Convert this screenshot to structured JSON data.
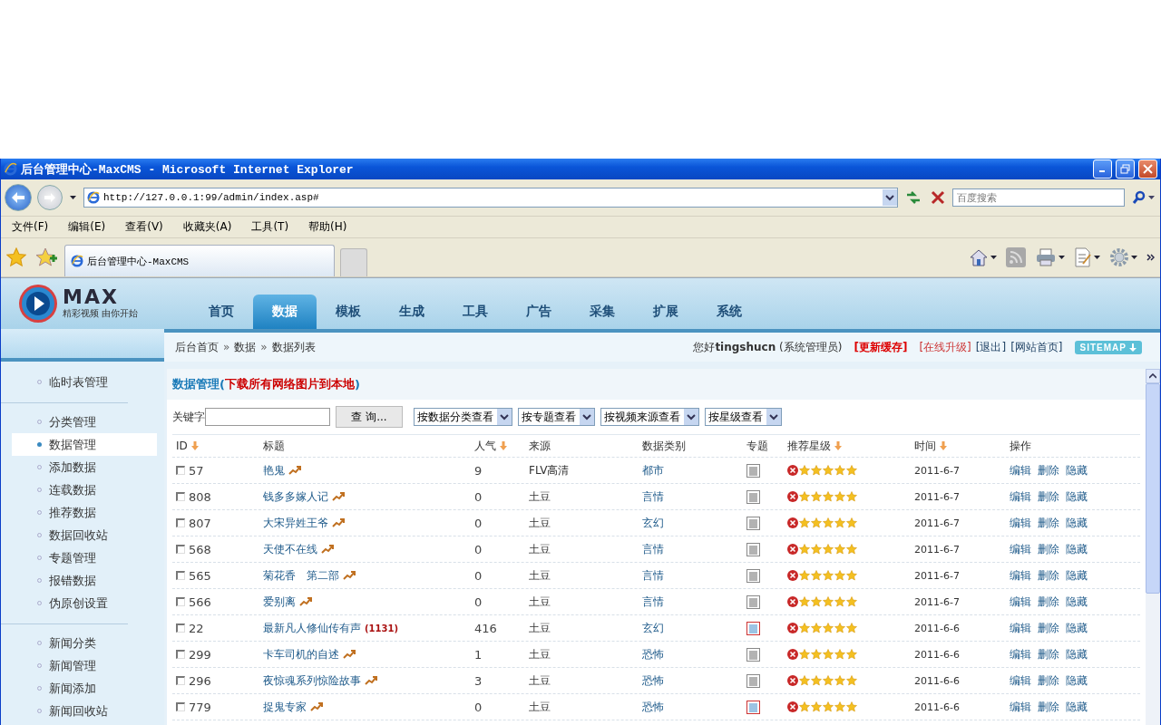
{
  "browser": {
    "title": "后台管理中心-MaxCMS - Microsoft Internet Explorer",
    "address": "http://127.0.0.1:99/admin/index.asp#",
    "search_placeholder": "百度搜索",
    "menu": [
      "文件(F)",
      "编辑(E)",
      "查看(V)",
      "收藏夹(A)",
      "工具(T)",
      "帮助(H)"
    ],
    "tab": "后台管理中心-MaxCMS"
  },
  "logo": {
    "wordmark": "MAX",
    "slogan": "精彩视频 由你开始"
  },
  "nav": [
    {
      "label": "首页",
      "selected": false
    },
    {
      "label": "数据",
      "selected": true
    },
    {
      "label": "模板",
      "selected": false
    },
    {
      "label": "生成",
      "selected": false
    },
    {
      "label": "工具",
      "selected": false
    },
    {
      "label": "广告",
      "selected": false
    },
    {
      "label": "采集",
      "selected": false
    },
    {
      "label": "扩展",
      "selected": false
    },
    {
      "label": "系统",
      "selected": false
    }
  ],
  "breadcrumb": {
    "separator": "»",
    "items": [
      "后台首页",
      "数据",
      "数据列表"
    ]
  },
  "user": {
    "greeting": "您好",
    "name": "tingshucn",
    "role": "(系统管理员)",
    "sitemap": "SITEMAP",
    "links": [
      {
        "label": "[更新缓存]",
        "kind": "strong"
      },
      {
        "label": "[在线升级]",
        "kind": "warn"
      },
      {
        "label": "[退出]",
        "kind": "plain"
      },
      {
        "label": "[网站首页]",
        "kind": "plain"
      }
    ]
  },
  "sidebar": {
    "groups": [
      [
        {
          "label": "临时表管理",
          "selected": false
        }
      ],
      [
        {
          "label": "分类管理",
          "selected": false
        },
        {
          "label": "数据管理",
          "selected": true
        },
        {
          "label": "添加数据",
          "selected": false
        },
        {
          "label": "连载数据",
          "selected": false
        },
        {
          "label": "推荐数据",
          "selected": false
        },
        {
          "label": "数据回收站",
          "selected": false
        },
        {
          "label": "专题管理",
          "selected": false
        },
        {
          "label": "报错数据",
          "selected": false
        },
        {
          "label": "伪原创设置",
          "selected": false
        }
      ],
      [
        {
          "label": "新闻分类",
          "selected": false
        },
        {
          "label": "新闻管理",
          "selected": false
        },
        {
          "label": "新闻添加",
          "selected": false
        },
        {
          "label": "新闻回收站",
          "selected": false
        }
      ]
    ]
  },
  "panel": {
    "title": "数据管理",
    "paren_open": "(",
    "link": "下载所有网络图片到本地",
    "paren_close": ")"
  },
  "filter": {
    "keyword_label": "关键字",
    "button": "查 询...",
    "selects": [
      "按数据分类查看",
      "按专题查看",
      "按视频来源查看",
      "按星级查看"
    ]
  },
  "table": {
    "columns": [
      {
        "label": "ID",
        "sortable": true
      },
      {
        "label": "标题",
        "sortable": false
      },
      {
        "label": "人气",
        "sortable": true
      },
      {
        "label": "来源",
        "sortable": false
      },
      {
        "label": "数据类别",
        "sortable": false
      },
      {
        "label": "专题",
        "sortable": false
      },
      {
        "label": "推荐星级",
        "sortable": true
      },
      {
        "label": "时间",
        "sortable": true
      },
      {
        "label": "操作",
        "sortable": false
      }
    ],
    "rows": [
      {
        "checked": false,
        "id": "57",
        "title": "艳鬼",
        "trend": true,
        "views": "9",
        "source": "FLV高清",
        "category": "都市",
        "topic_set": false,
        "stars": 5,
        "time": "2011-6-7",
        "actions": [
          "编辑",
          "删除",
          "隐藏"
        ]
      },
      {
        "checked": false,
        "id": "808",
        "title": "钱多多嫁人记",
        "trend": true,
        "views": "0",
        "source": "土豆",
        "category": "言情",
        "topic_set": false,
        "stars": 5,
        "time": "2011-6-7",
        "actions": [
          "编辑",
          "删除",
          "隐藏"
        ]
      },
      {
        "checked": false,
        "id": "807",
        "title": "大宋异姓王爷",
        "trend": true,
        "views": "0",
        "source": "土豆",
        "category": "玄幻",
        "topic_set": false,
        "stars": 5,
        "time": "2011-6-7",
        "actions": [
          "编辑",
          "删除",
          "隐藏"
        ]
      },
      {
        "checked": false,
        "id": "568",
        "title": "天使不在线",
        "trend": true,
        "views": "0",
        "source": "土豆",
        "category": "言情",
        "topic_set": false,
        "stars": 5,
        "time": "2011-6-7",
        "actions": [
          "编辑",
          "删除",
          "隐藏"
        ]
      },
      {
        "checked": false,
        "id": "565",
        "title": "菊花香　第二部",
        "trend": true,
        "views": "0",
        "source": "土豆",
        "category": "言情",
        "topic_set": false,
        "stars": 5,
        "time": "2011-6-7",
        "actions": [
          "编辑",
          "删除",
          "隐藏"
        ]
      },
      {
        "checked": false,
        "id": "566",
        "title": "爱别离",
        "trend": true,
        "views": "0",
        "source": "土豆",
        "category": "言情",
        "topic_set": false,
        "stars": 5,
        "time": "2011-6-7",
        "actions": [
          "编辑",
          "删除",
          "隐藏"
        ]
      },
      {
        "checked": false,
        "id": "22",
        "title": "最新凡人修仙传有声",
        "trend": false,
        "count": "(1131)",
        "views": "416",
        "source": "土豆",
        "category": "玄幻",
        "topic_set": true,
        "stars": 5,
        "time": "2011-6-6",
        "actions": [
          "编辑",
          "删除",
          "隐藏"
        ]
      },
      {
        "checked": false,
        "id": "299",
        "title": "卡车司机的自述",
        "trend": true,
        "views": "1",
        "source": "土豆",
        "category": "恐怖",
        "topic_set": false,
        "stars": 5,
        "time": "2011-6-6",
        "actions": [
          "编辑",
          "删除",
          "隐藏"
        ]
      },
      {
        "checked": false,
        "id": "296",
        "title": "夜惊魂系列惊险故事",
        "trend": true,
        "views": "3",
        "source": "土豆",
        "category": "恐怖",
        "topic_set": false,
        "stars": 5,
        "time": "2011-6-6",
        "actions": [
          "编辑",
          "删除",
          "隐藏"
        ]
      },
      {
        "checked": false,
        "id": "779",
        "title": "捉鬼专家",
        "trend": true,
        "views": "0",
        "source": "土豆",
        "category": "恐怖",
        "topic_set": true,
        "stars": 5,
        "time": "2011-6-6",
        "actions": [
          "编辑",
          "删除",
          "隐藏"
        ]
      }
    ]
  }
}
